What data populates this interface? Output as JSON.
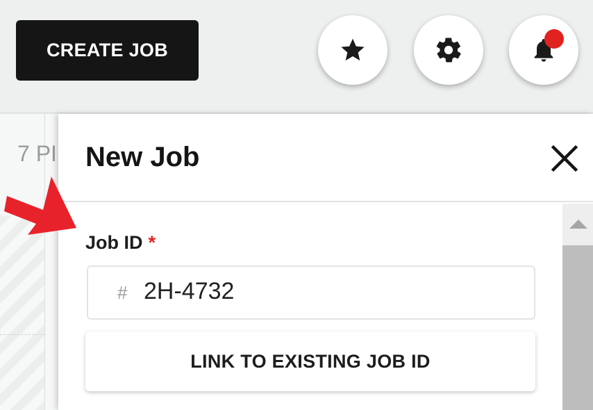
{
  "toolbar": {
    "create_job_label": "CREATE JOB",
    "favorites_icon": "star-icon",
    "settings_icon": "gear-icon",
    "notifications_icon": "bell-icon",
    "notification_dot_color": "#e0231f"
  },
  "background": {
    "time_label": "7 PI"
  },
  "panel": {
    "title": "New Job",
    "close_icon": "close-icon",
    "job_id_label": "Job ID",
    "required_marker": "*",
    "job_id_prefix_icon": "#",
    "job_id_value": "2H-4732",
    "link_button_label": "LINK TO EXISTING JOB ID"
  },
  "annotation": {
    "arrow_icon": "red-arrow-icon",
    "arrow_color": "#e8222a"
  }
}
